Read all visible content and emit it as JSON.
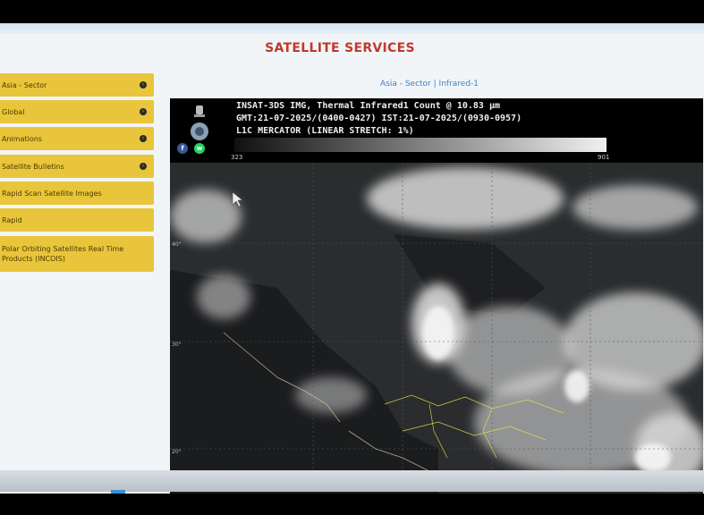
{
  "page": {
    "title": "SATELLITE SERVICES"
  },
  "sidebar": {
    "items": [
      {
        "label": "Asia - Sector",
        "has_arrow": true
      },
      {
        "label": "Global",
        "has_arrow": true
      },
      {
        "label": "Animations",
        "has_arrow": true
      },
      {
        "label": "Satellite Bulletins",
        "has_arrow": true
      },
      {
        "label": "Rapid Scan Satellite Images",
        "has_arrow": false
      },
      {
        "label": "Rapid",
        "has_arrow": false
      },
      {
        "label": "Polar Orbiting Satellites Real Time Products (INCOIS)",
        "has_arrow": false
      }
    ]
  },
  "breadcrumb": {
    "sector": "Asia - Sector",
    "separator": "|",
    "product": "Infrared-1"
  },
  "image": {
    "line1": "INSAT-3DS IMG, Thermal Infrared1 Count @ 10.83 μm",
    "line2": "GMT:21-07-2025/(0400-0427)  IST:21-07-2025/(0930-0957)",
    "line3": "L1C MERCATOR (LINEAR STRETCH: 1%)",
    "colorbar_min": "323",
    "colorbar_max": "901",
    "lat_labels": [
      "40°",
      "30°",
      "20°"
    ]
  },
  "social": {
    "facebook": "f",
    "whatsapp": "w"
  },
  "colors": {
    "accent": "#e8c53a",
    "title": "#c0392b",
    "link": "#3d7fc4"
  }
}
